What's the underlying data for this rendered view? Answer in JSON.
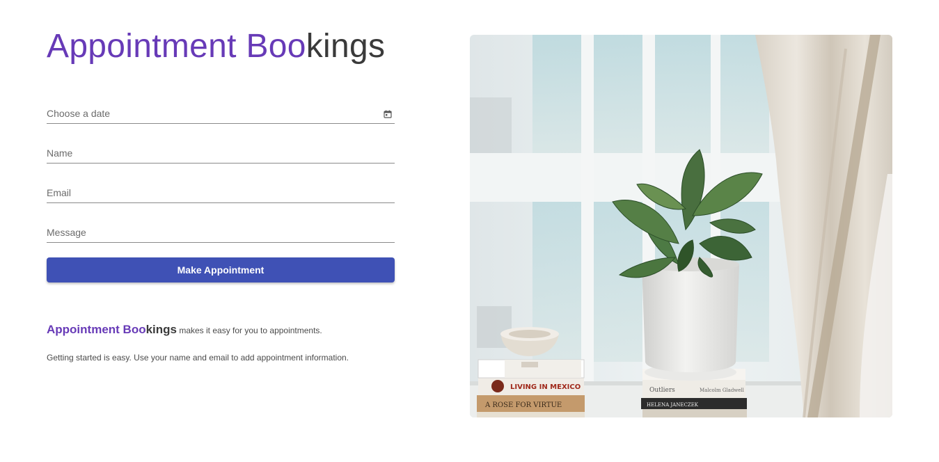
{
  "header": {
    "title_part1": "Appointment Boo",
    "title_part2": "kings"
  },
  "form": {
    "date_placeholder": "Choose a date",
    "name_placeholder": "Name",
    "email_placeholder": "Email",
    "message_placeholder": "Message",
    "submit_label": "Make Appointment"
  },
  "about": {
    "brand_part1": "Appointment Boo",
    "brand_part2": "kings",
    "tagline": " makes it easy for you to appointments.",
    "description": "Getting started is easy. Use your name and email to add appointment information."
  },
  "photo": {
    "book_spine_1": "LIVING IN MEXICO",
    "book_spine_2": "A ROSE FOR VIRTUE",
    "book_spine_3": "Outliers",
    "book_spine_4": "Malcolm Gladwell",
    "book_spine_5": "HELENA JANECZEK"
  },
  "colors": {
    "accent_purple": "#673ab7",
    "button_blue": "#3f51b5",
    "title_dark": "#3a3a3a"
  },
  "icons": {
    "date_picker": "calendar-icon"
  }
}
